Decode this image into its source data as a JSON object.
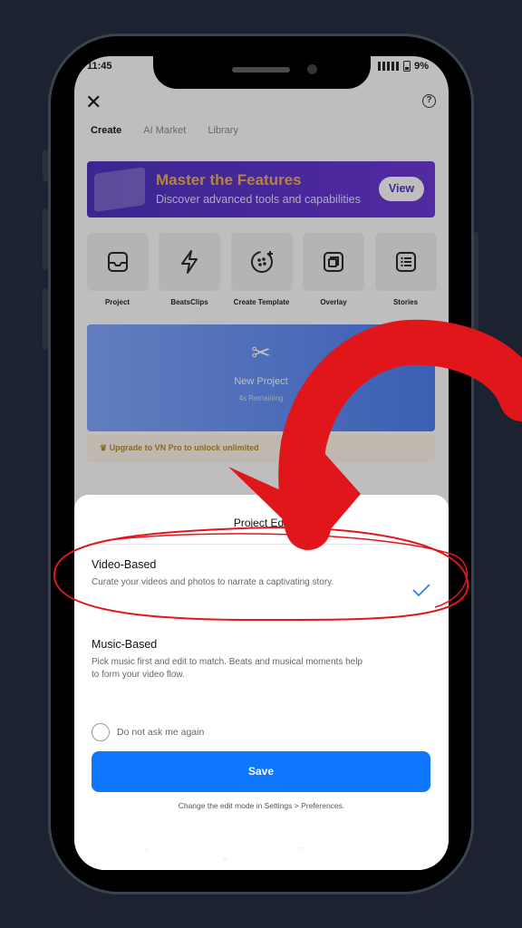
{
  "status_bar": {
    "time": "11:45",
    "battery": "9%"
  },
  "tabs": [
    {
      "label": "Create",
      "active": true
    },
    {
      "label": "AI Market",
      "active": false
    },
    {
      "label": "Library",
      "active": false
    }
  ],
  "banner": {
    "title": "Master the Features",
    "subtitle": "Discover advanced tools and capabilities",
    "button": "View"
  },
  "tools": [
    {
      "label": "Project",
      "icon": "inbox-icon"
    },
    {
      "label": "BeatsClips",
      "icon": "lightning-icon"
    },
    {
      "label": "Create Template",
      "icon": "template-icon"
    },
    {
      "label": "Overlay",
      "icon": "overlay-icon"
    },
    {
      "label": "Stories",
      "icon": "list-icon"
    }
  ],
  "new_project": {
    "title": "New Project",
    "subtitle": "4s Remaining"
  },
  "upgrade": {
    "text": "Upgrade to VN Pro to unlock unlimited"
  },
  "sheet": {
    "title": "Project Edit",
    "options": [
      {
        "title": "Video-Based",
        "description": "Curate your videos and photos to narrate a captivating story.",
        "selected": true
      },
      {
        "title": "Music-Based",
        "description": "Pick music first and edit to match. Beats and musical moments help to form your video flow.",
        "selected": false
      }
    ],
    "do_not_ask": "Do not ask me again",
    "save_label": "Save",
    "hint": "Change the edit mode in Settings > Preferences."
  },
  "colors": {
    "accent": "#0e76fd",
    "banner": "#5a30d0",
    "banner_title": "#f2b24a",
    "annotation": "#e0161b",
    "background": "#1d2230"
  }
}
